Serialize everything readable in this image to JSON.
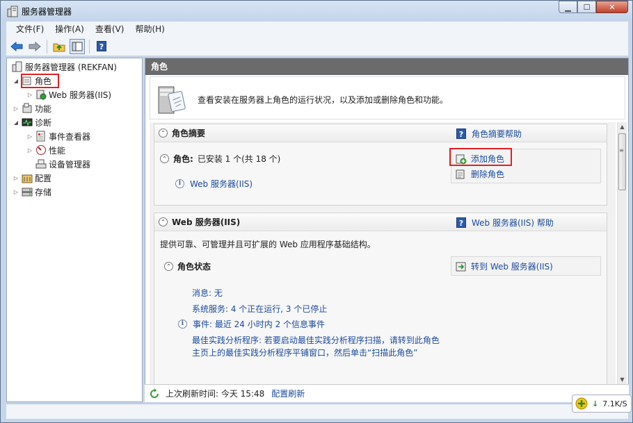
{
  "window": {
    "title": "服务器管理器"
  },
  "menubar": {
    "items": [
      "文件(F)",
      "操作(A)",
      "查看(V)",
      "帮助(H)"
    ]
  },
  "toolbar": {
    "buttons": [
      "back-icon",
      "forward-icon",
      "up-folder-icon",
      "show-hide-console-icon",
      "help-icon"
    ]
  },
  "tree": {
    "root": "服务器管理器 (REKFAN)",
    "roles": "角色",
    "web_iis": "Web 服务器(IIS)",
    "features": "功能",
    "diagnostics": "诊断",
    "event_viewer": "事件查看器",
    "performance": "性能",
    "device_manager": "设备管理器",
    "configuration": "配置",
    "storage": "存储"
  },
  "main": {
    "header": "角色",
    "intro": "查看安装在服务器上角色的运行状况，以及添加或删除角色和功能。",
    "summary": {
      "title": "角色摘要",
      "help_link": "角色摘要帮助",
      "roles_label": "角色:",
      "roles_value": "已安装 1 个(共 18 个)",
      "installed_role": "Web 服务器(IIS)",
      "add_roles": "添加角色",
      "remove_roles": "删除角色"
    },
    "web": {
      "title": "Web 服务器(IIS)",
      "help_link": "Web 服务器(IIS) 帮助",
      "description": "提供可靠、可管理并且可扩展的 Web 应用程序基础结构。",
      "status_title": "角色状态",
      "goto_link": "转到 Web 服务器(IIS)",
      "messages": "消息: 无",
      "services": "系统服务: 4 个正在运行, 3 个已停止",
      "events": "事件: 最近 24 小时内 2 个信息事件",
      "bpa_line1": "最佳实践分析程序: 若要启动最佳实践分析程序扫描，请转到此角色",
      "bpa_line2": "主页上的最佳实践分析程序平铺窗口，然后单击“扫描此角色”"
    }
  },
  "status": {
    "last_refresh": "上次刷新时间: 今天 15:48",
    "configure_refresh": "配置刷新"
  },
  "net_widget": {
    "speed": "7.1K/S"
  },
  "colors": {
    "highlight": "#e02020",
    "link": "#1a4a9c",
    "header_bg": "#6b6b6b"
  }
}
